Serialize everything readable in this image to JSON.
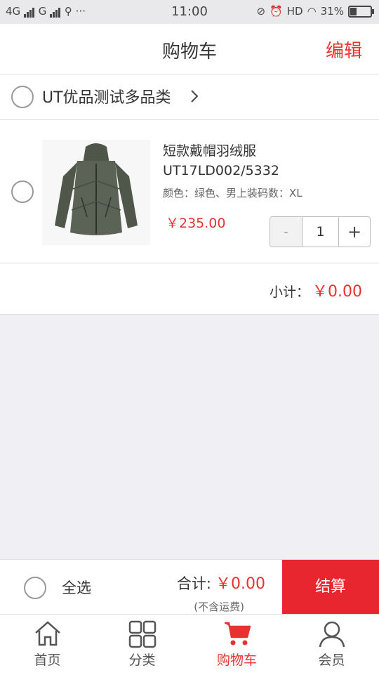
{
  "status_bar": {
    "network_left": "4G",
    "network_right": "G",
    "usb_more": "⚲ ···",
    "time": "11:00",
    "hd": "HD",
    "battery": "31%"
  },
  "header": {
    "title": "购物车",
    "edit_label": "编辑"
  },
  "shop": {
    "name": "UT优品测试多品类"
  },
  "item": {
    "name": "短款戴帽羽绒服 UT17LD002/5332",
    "spec": "颜色：绿色、男上装码数：XL",
    "price": "￥235.00",
    "quantity": "1",
    "minus": "-",
    "plus": "+"
  },
  "subtotal": {
    "label": "小计：",
    "value": "￥0.00"
  },
  "checkout": {
    "select_all": "全选",
    "total_label": "合计:",
    "total_value": "￥0.00",
    "shipping_note": "(不含运费)",
    "button": "结算"
  },
  "tabbar": {
    "tabs": [
      {
        "label": "首页",
        "icon": "home-icon"
      },
      {
        "label": "分类",
        "icon": "grid-icon"
      },
      {
        "label": "购物车",
        "icon": "cart-icon"
      },
      {
        "label": "会员",
        "icon": "user-icon"
      }
    ],
    "active_index": 2
  },
  "colors": {
    "accent": "#e8322f",
    "checkout_button": "#e8262f",
    "background": "#efeff4"
  }
}
